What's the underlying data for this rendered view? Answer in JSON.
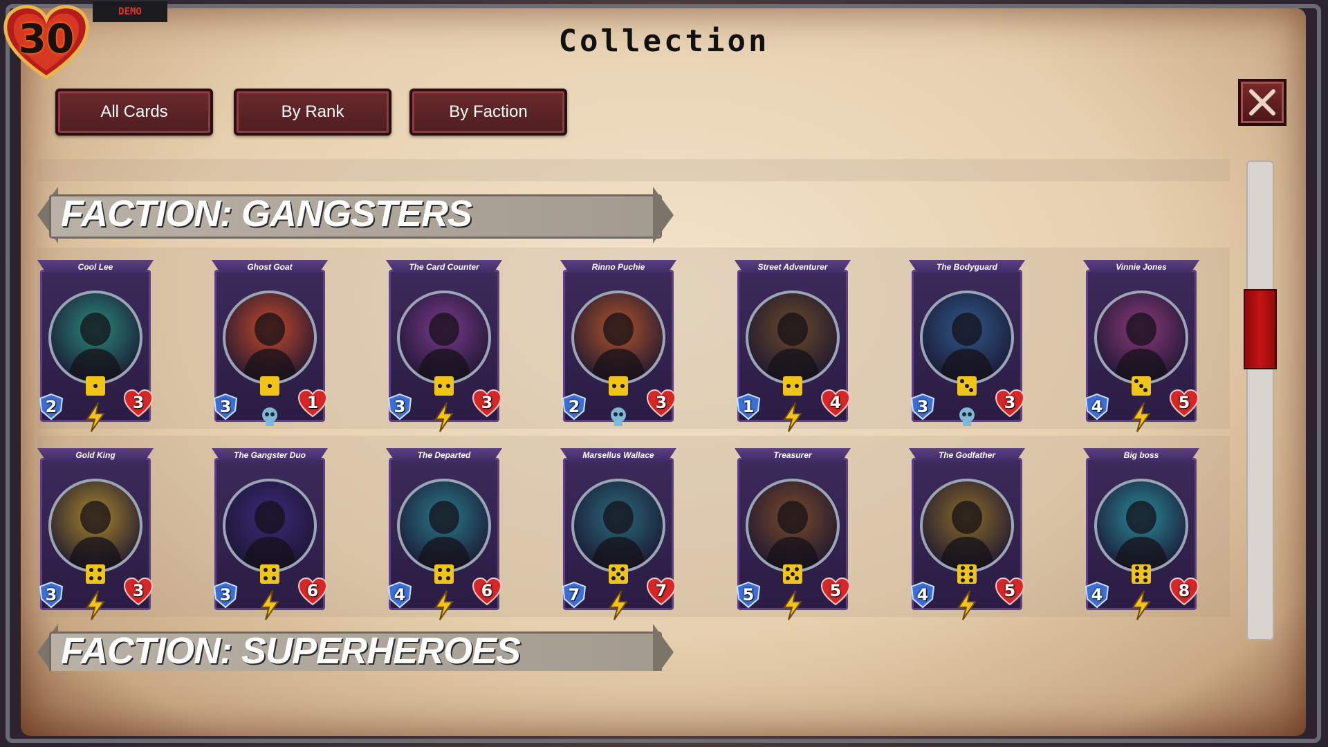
{
  "lives": "30",
  "demo_label": "DEMO",
  "title": "Collection",
  "tabs": [
    "All Cards",
    "By Rank",
    "By Faction"
  ],
  "factions": {
    "gangsters": "FACTION: GANGSTERS",
    "superheroes": "FACTION: SUPERHEROES"
  },
  "cards": [
    {
      "name": "Cool Lee",
      "attack": "2",
      "health": "3",
      "dice": 1,
      "portrait": "#2a8a7a",
      "bolt": true
    },
    {
      "name": "Ghost Goat",
      "attack": "3",
      "health": "1",
      "dice": 1,
      "portrait": "#c44a2a",
      "bolt": false
    },
    {
      "name": "The Card Counter",
      "attack": "3",
      "health": "3",
      "dice": 2,
      "portrait": "#7a3a8a",
      "bolt": true
    },
    {
      "name": "Rinno Puchie",
      "attack": "2",
      "health": "3",
      "dice": 2,
      "portrait": "#b0542a",
      "bolt": false
    },
    {
      "name": "Street Adventurer",
      "attack": "1",
      "health": "4",
      "dice": 2,
      "portrait": "#6a4a2a",
      "bolt": true
    },
    {
      "name": "The Bodyguard",
      "attack": "3",
      "health": "3",
      "dice": 3,
      "portrait": "#2f5a8a",
      "bolt": false
    },
    {
      "name": "Vinnie Jones",
      "attack": "4",
      "health": "5",
      "dice": 3,
      "portrait": "#8a3a7a",
      "bolt": true
    },
    {
      "name": "Gold King",
      "attack": "3",
      "health": "3",
      "dice": 4,
      "portrait": "#a8862a",
      "bolt": true
    },
    {
      "name": "The Gangster Duo",
      "attack": "3",
      "health": "6",
      "dice": 4,
      "portrait": "#3a2a7a",
      "bolt": true
    },
    {
      "name": "The Departed",
      "attack": "4",
      "health": "6",
      "dice": 4,
      "portrait": "#2a7a8a",
      "bolt": true
    },
    {
      "name": "Marsellus Wallace",
      "attack": "7",
      "health": "7",
      "dice": 5,
      "portrait": "#2a6a7a",
      "bolt": true
    },
    {
      "name": "Treasurer",
      "attack": "5",
      "health": "5",
      "dice": 5,
      "portrait": "#7a4a2a",
      "bolt": true
    },
    {
      "name": "The Godfather",
      "attack": "4",
      "health": "5",
      "dice": 6,
      "portrait": "#8a6a2a",
      "bolt": true
    },
    {
      "name": "Big boss",
      "attack": "4",
      "health": "8",
      "dice": 6,
      "portrait": "#2a8a9a",
      "bolt": true
    }
  ],
  "colors": {
    "tab_bg": "#5a2226",
    "thumb": "#b01212",
    "card_frame": "#3c2a5a"
  }
}
